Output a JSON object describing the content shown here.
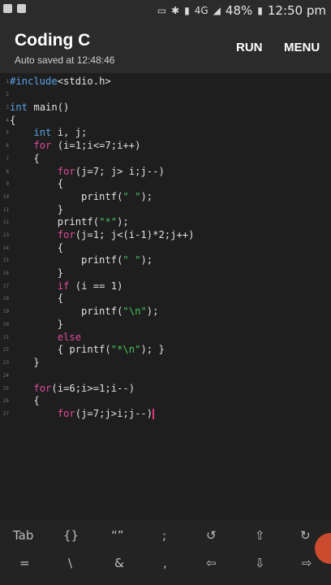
{
  "status": {
    "battery": "48%",
    "time": "12:50 pm",
    "network": "4G"
  },
  "appbar": {
    "title": "Coding C",
    "subtitle": "Auto saved at 12:48:46",
    "run": "RUN",
    "menu": "MENU"
  },
  "code": [
    {
      "n": "1",
      "t": "#include<stdio.h>"
    },
    {
      "n": "2",
      "t": ""
    },
    {
      "n": "3",
      "t": "int main()"
    },
    {
      "n": "4",
      "t": "{"
    },
    {
      "n": "5",
      "t": "    int i, j;"
    },
    {
      "n": "6",
      "t": "    for (i=1;i<=7;i++)"
    },
    {
      "n": "7",
      "t": "    {"
    },
    {
      "n": "8",
      "t": "        for(j=7; j> i;j--)"
    },
    {
      "n": "9",
      "t": "        {"
    },
    {
      "n": "10",
      "t": "            printf(\" \");"
    },
    {
      "n": "11",
      "t": "        }"
    },
    {
      "n": "12",
      "t": "        printf(\"*\");"
    },
    {
      "n": "13",
      "t": "        for(j=1; j<(i-1)*2;j++)"
    },
    {
      "n": "14",
      "t": "        {"
    },
    {
      "n": "15",
      "t": "            printf(\" \");"
    },
    {
      "n": "16",
      "t": "        }"
    },
    {
      "n": "17",
      "t": "        if (i == 1)"
    },
    {
      "n": "18",
      "t": "        {"
    },
    {
      "n": "19",
      "t": "            printf(\"\\n\");"
    },
    {
      "n": "20",
      "t": "        }"
    },
    {
      "n": "21",
      "t": "        else"
    },
    {
      "n": "22",
      "t": "        { printf(\"*\\n\"); }"
    },
    {
      "n": "23",
      "t": "    }"
    },
    {
      "n": "24",
      "t": ""
    },
    {
      "n": "25",
      "t": "    for(i=6;i>=1;i--)"
    },
    {
      "n": "26",
      "t": "    {"
    },
    {
      "n": "27",
      "t": "        for(j=7;j>i;j--)"
    }
  ],
  "keys_row1": [
    "Tab",
    "{}",
    "“”",
    ";",
    "↺",
    "⇧",
    "↻"
  ],
  "keys_row2": [
    "=",
    "\\",
    "&",
    ",",
    "⇦",
    "⇩",
    "⇨"
  ],
  "colors": {
    "keyword": "#e24a9e",
    "type": "#5aa3e6",
    "string": "#45c45b",
    "caret": "#e8337a"
  }
}
